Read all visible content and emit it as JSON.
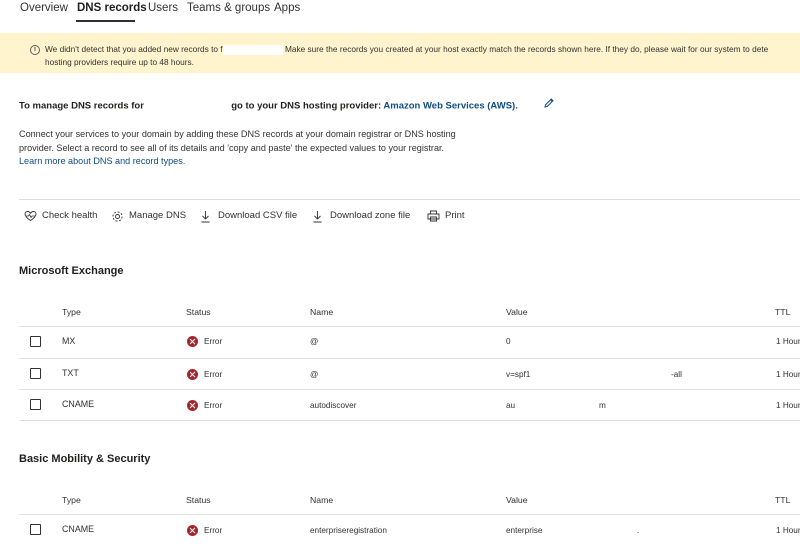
{
  "tabs": [
    {
      "label": "Overview"
    },
    {
      "label": "DNS records",
      "active": true
    },
    {
      "label": "Users"
    },
    {
      "label": "Teams & groups"
    },
    {
      "label": "Apps"
    }
  ],
  "banner": {
    "icon": "info-icon",
    "line1_start": "We didn't detect that you added new records to f",
    "line1_end": "Make sure the records you created at your host exactly match the records shown here. If they do, please wait for our system to dete",
    "line2": "hosting providers require up to 48 hours."
  },
  "manage": {
    "prefix": "To manage DNS records for",
    "middle": "go to your DNS hosting provider:",
    "provider": "Amazon Web Services (AWS).",
    "edit_icon": "pencil-icon"
  },
  "description": {
    "text": "Connect your services to your domain by adding these DNS records at your domain registrar or DNS hosting provider. Select a record to see all of its details and 'copy and paste' the expected values to your registrar.",
    "link": "Learn more about DNS and record types."
  },
  "toolbar": [
    {
      "label": "Check health",
      "icon": "heart-icon"
    },
    {
      "label": "Manage DNS",
      "icon": "gear-icon"
    },
    {
      "label": "Download CSV file",
      "icon": "download-icon"
    },
    {
      "label": "Download zone file",
      "icon": "download-icon"
    },
    {
      "label": "Print",
      "icon": "printer-icon"
    }
  ],
  "columns": {
    "type": "Type",
    "status": "Status",
    "name": "Name",
    "value": "Value",
    "ttl": "TTL"
  },
  "sections": [
    {
      "title": "Microsoft Exchange",
      "rows": [
        {
          "type": "MX",
          "status": "Error",
          "name": "@",
          "value": "0",
          "ttl": "1 Hour"
        },
        {
          "type": "TXT",
          "status": "Error",
          "name": "@",
          "value": "v=spf1",
          "value_end": "-all",
          "ttl": "1 Hour"
        },
        {
          "type": "CNAME",
          "status": "Error",
          "name": "autodiscover",
          "value": "au",
          "value_end": "m",
          "ttl": "1 Hour"
        }
      ]
    },
    {
      "title": "Basic Mobility & Security",
      "rows": [
        {
          "type": "CNAME",
          "status": "Error",
          "name": "enterpriseregistration",
          "value": "enterprise",
          "value_end": ".",
          "ttl": "1 Hour"
        }
      ]
    }
  ],
  "colors": {
    "error": "#a4262c",
    "banner_bg": "#fff4ce",
    "link": "#0f4c81"
  }
}
